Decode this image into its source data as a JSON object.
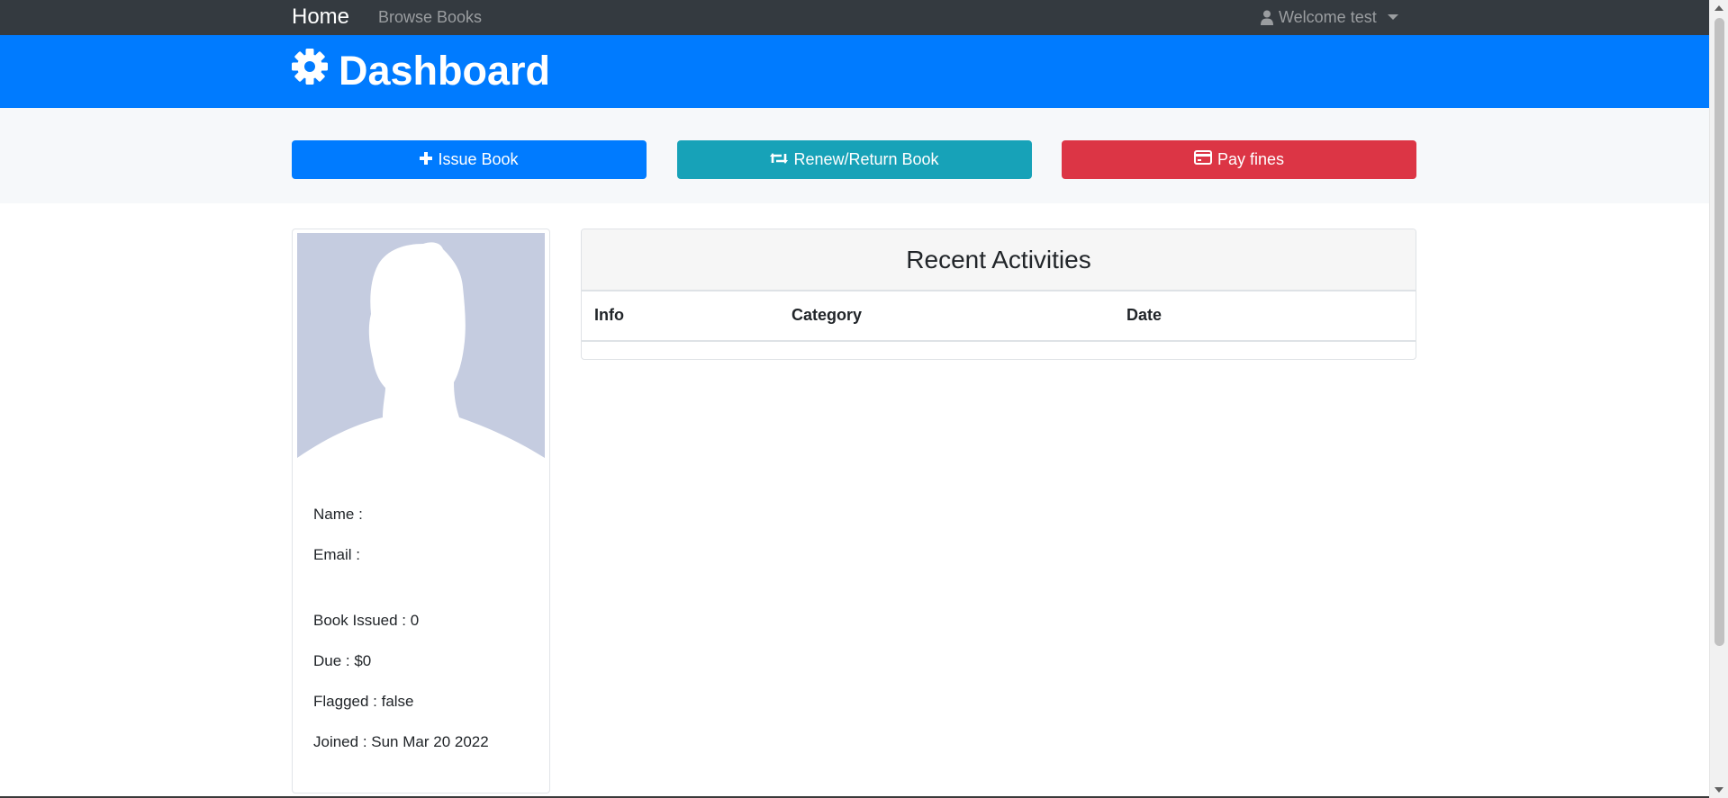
{
  "navbar": {
    "brand": "Home",
    "browse_link": "Browse Books",
    "user_menu": "Welcome test"
  },
  "header": {
    "title": "Dashboard",
    "icon": "gear-icon"
  },
  "actions": {
    "issue_label": "Issue Book",
    "renew_label": "Renew/Return Book",
    "pay_label": "Pay fines"
  },
  "profile": {
    "name_label": "Name :",
    "email_label": "Email :",
    "book_issued": "Book Issued : 0",
    "due": "Due : $0",
    "flagged": "Flagged : false",
    "joined": "Joined : Sun Mar 20 2022"
  },
  "activities": {
    "title": "Recent Activities",
    "columns": [
      "Info",
      "Category",
      "Date"
    ]
  },
  "colors": {
    "navbar": "#343a40",
    "primary": "#007bff",
    "info": "#17a2b8",
    "danger": "#dc3545"
  }
}
